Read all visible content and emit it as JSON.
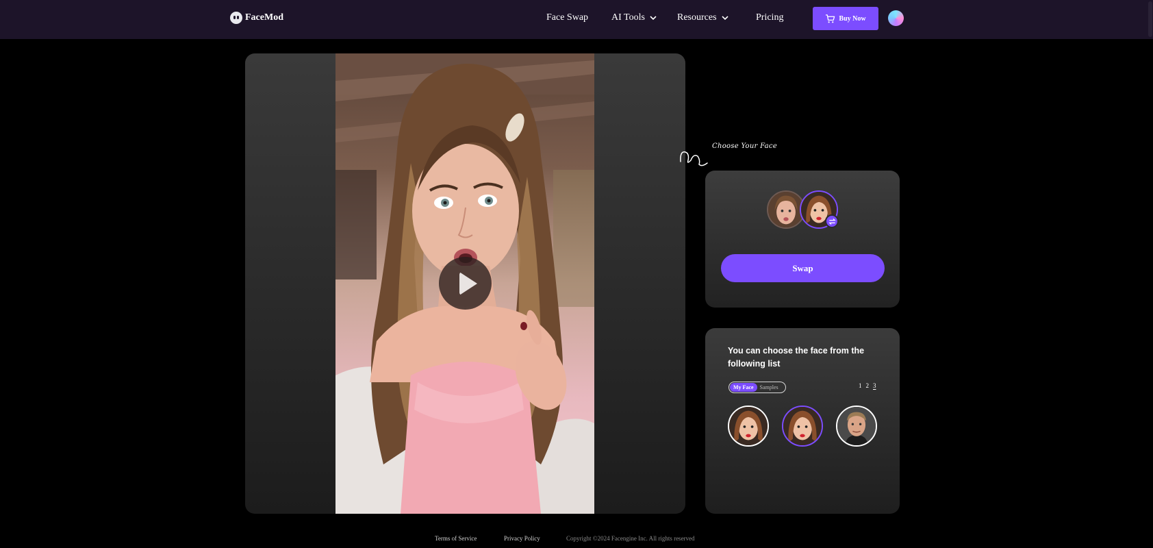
{
  "header": {
    "logo_text": "FaceMod",
    "nav": {
      "face_swap": "Face Swap",
      "ai_tools": "AI Tools",
      "resources": "Resources",
      "pricing": "Pricing"
    },
    "buy_now": "Buy Now"
  },
  "colors": {
    "header_bg": "#1d1429",
    "accent": "#7c4dff",
    "page_bg": "#000000"
  },
  "choose_face": {
    "label": "Choose Your Face"
  },
  "swap_card": {
    "button_label": "Swap"
  },
  "face_list": {
    "title": "You can choose the face from the following list",
    "tabs": {
      "my_face": "My Face",
      "samples": "Samples"
    },
    "pages": [
      "1",
      "2",
      "3"
    ],
    "active_page": "3"
  },
  "footer": {
    "terms": "Terms of Service",
    "privacy": "Privacy Policy",
    "copyright": "Copyright ©2024 Facengine Inc. All rights reserved"
  }
}
